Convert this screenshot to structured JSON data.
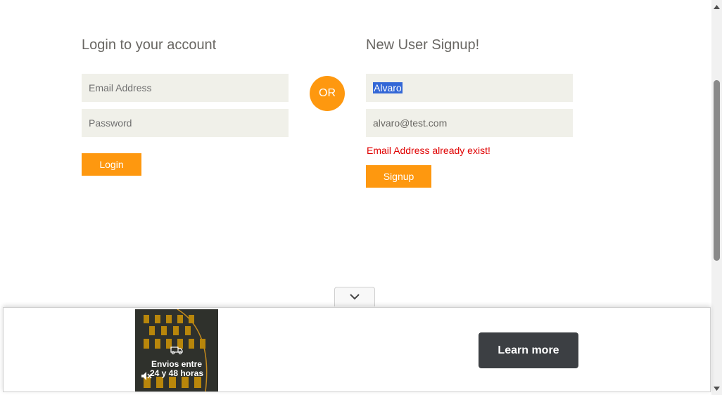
{
  "login": {
    "heading": "Login to your account",
    "email_placeholder": "Email Address",
    "password_placeholder": "Password",
    "button_label": "Login"
  },
  "divider": {
    "label": "OR"
  },
  "signup": {
    "heading": "New User Signup!",
    "name_value": "Alvaro",
    "email_value": "alvaro@test.com",
    "error_message": "Email Address already exist!",
    "button_label": "Signup"
  },
  "ad": {
    "caption_line1": "Envios entre",
    "caption_line2": "24 y 48 horas",
    "cta_label": "Learn more",
    "collapse_icon": "chevron-down-icon",
    "mute_icon": "mute-icon"
  },
  "colors": {
    "accent": "#FE980F",
    "field_bg": "#F0F0E9",
    "error": "#e00000",
    "cta_bg": "#3c3f43"
  }
}
